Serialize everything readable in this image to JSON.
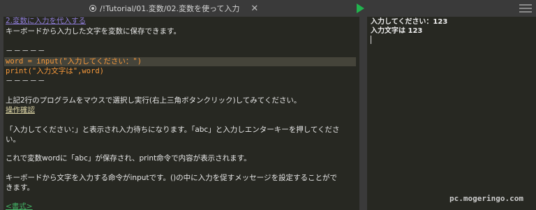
{
  "tab": {
    "title": "/!Tutorial/01.変数/02.変数を使って入力",
    "close": "✕"
  },
  "editor": {
    "top_partial": "2.変数に入力を代入する",
    "intro": "キーボードから入力した文字を変数に保存できます。",
    "dashes1": "－－－－－",
    "code1": {
      "var": "word",
      "eq": " = ",
      "func": "input",
      "args": "(\"入力してください：\")"
    },
    "code2": {
      "func": "print",
      "args": "(\"入力文字は\",word)"
    },
    "dashes2": "－－－－－",
    "instruction": "上記2行のプログラムをマウスで選択し実行(右上三角ボタンクリック)してみてください。",
    "link": "操作確認",
    "para1_line1": "「入力してください：」と表示され入力待ちになります。「abc」と入力しエンターキーを押してくださ",
    "para1_line2": "い。",
    "para2": "これで変数wordに「abc」が保存され、print命令で内容が表示されます。",
    "para3_line1": "キーボードから文字を入力する命令がinputです。()の中に入力を促すメッセージを設定することがで",
    "para3_line2": "きます。",
    "bottom_partial": "<書式>"
  },
  "output": {
    "line1": "入力してください：123",
    "line2": "入力文字は 123"
  },
  "watermark": "pc.mogeringo.com",
  "colors": {
    "run": "#21b34e",
    "keyword": "#f99a3c",
    "background": "#272822"
  },
  "icons": {
    "run": "play-icon",
    "menu": "hamburger-icon",
    "tab": "record-icon"
  }
}
